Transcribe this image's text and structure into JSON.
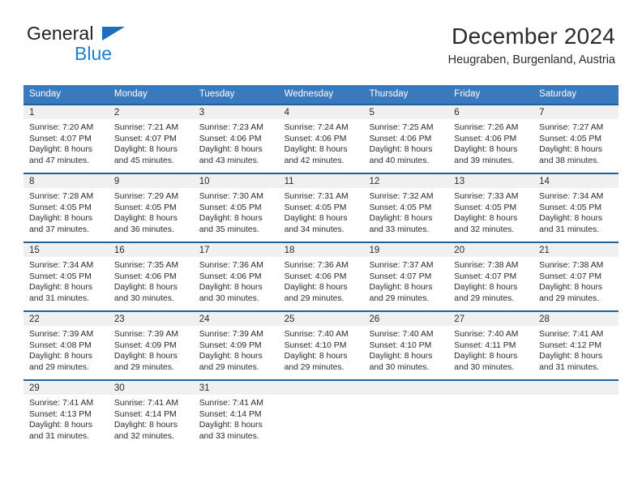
{
  "brand": {
    "name_line1": "General",
    "name_line2": "Blue",
    "triangle_color": "#1b6fc1",
    "blue_text_color": "#1b7fd4"
  },
  "header": {
    "title": "December 2024",
    "subtitle": "Heugraben, Burgenland, Austria"
  },
  "theme": {
    "header_blue": "#3b79bd",
    "cell_border_blue": "#20609f",
    "day_band_gray": "#f0f0f0",
    "text_color": "#2b2b2b"
  },
  "weekdays": [
    "Sunday",
    "Monday",
    "Tuesday",
    "Wednesday",
    "Thursday",
    "Friday",
    "Saturday"
  ],
  "weeks": [
    [
      {
        "day": "1",
        "sunrise": "Sunrise: 7:20 AM",
        "sunset": "Sunset: 4:07 PM",
        "daylight_line1": "Daylight: 8 hours",
        "daylight_line2": "and 47 minutes."
      },
      {
        "day": "2",
        "sunrise": "Sunrise: 7:21 AM",
        "sunset": "Sunset: 4:07 PM",
        "daylight_line1": "Daylight: 8 hours",
        "daylight_line2": "and 45 minutes."
      },
      {
        "day": "3",
        "sunrise": "Sunrise: 7:23 AM",
        "sunset": "Sunset: 4:06 PM",
        "daylight_line1": "Daylight: 8 hours",
        "daylight_line2": "and 43 minutes."
      },
      {
        "day": "4",
        "sunrise": "Sunrise: 7:24 AM",
        "sunset": "Sunset: 4:06 PM",
        "daylight_line1": "Daylight: 8 hours",
        "daylight_line2": "and 42 minutes."
      },
      {
        "day": "5",
        "sunrise": "Sunrise: 7:25 AM",
        "sunset": "Sunset: 4:06 PM",
        "daylight_line1": "Daylight: 8 hours",
        "daylight_line2": "and 40 minutes."
      },
      {
        "day": "6",
        "sunrise": "Sunrise: 7:26 AM",
        "sunset": "Sunset: 4:06 PM",
        "daylight_line1": "Daylight: 8 hours",
        "daylight_line2": "and 39 minutes."
      },
      {
        "day": "7",
        "sunrise": "Sunrise: 7:27 AM",
        "sunset": "Sunset: 4:05 PM",
        "daylight_line1": "Daylight: 8 hours",
        "daylight_line2": "and 38 minutes."
      }
    ],
    [
      {
        "day": "8",
        "sunrise": "Sunrise: 7:28 AM",
        "sunset": "Sunset: 4:05 PM",
        "daylight_line1": "Daylight: 8 hours",
        "daylight_line2": "and 37 minutes."
      },
      {
        "day": "9",
        "sunrise": "Sunrise: 7:29 AM",
        "sunset": "Sunset: 4:05 PM",
        "daylight_line1": "Daylight: 8 hours",
        "daylight_line2": "and 36 minutes."
      },
      {
        "day": "10",
        "sunrise": "Sunrise: 7:30 AM",
        "sunset": "Sunset: 4:05 PM",
        "daylight_line1": "Daylight: 8 hours",
        "daylight_line2": "and 35 minutes."
      },
      {
        "day": "11",
        "sunrise": "Sunrise: 7:31 AM",
        "sunset": "Sunset: 4:05 PM",
        "daylight_line1": "Daylight: 8 hours",
        "daylight_line2": "and 34 minutes."
      },
      {
        "day": "12",
        "sunrise": "Sunrise: 7:32 AM",
        "sunset": "Sunset: 4:05 PM",
        "daylight_line1": "Daylight: 8 hours",
        "daylight_line2": "and 33 minutes."
      },
      {
        "day": "13",
        "sunrise": "Sunrise: 7:33 AM",
        "sunset": "Sunset: 4:05 PM",
        "daylight_line1": "Daylight: 8 hours",
        "daylight_line2": "and 32 minutes."
      },
      {
        "day": "14",
        "sunrise": "Sunrise: 7:34 AM",
        "sunset": "Sunset: 4:05 PM",
        "daylight_line1": "Daylight: 8 hours",
        "daylight_line2": "and 31 minutes."
      }
    ],
    [
      {
        "day": "15",
        "sunrise": "Sunrise: 7:34 AM",
        "sunset": "Sunset: 4:05 PM",
        "daylight_line1": "Daylight: 8 hours",
        "daylight_line2": "and 31 minutes."
      },
      {
        "day": "16",
        "sunrise": "Sunrise: 7:35 AM",
        "sunset": "Sunset: 4:06 PM",
        "daylight_line1": "Daylight: 8 hours",
        "daylight_line2": "and 30 minutes."
      },
      {
        "day": "17",
        "sunrise": "Sunrise: 7:36 AM",
        "sunset": "Sunset: 4:06 PM",
        "daylight_line1": "Daylight: 8 hours",
        "daylight_line2": "and 30 minutes."
      },
      {
        "day": "18",
        "sunrise": "Sunrise: 7:36 AM",
        "sunset": "Sunset: 4:06 PM",
        "daylight_line1": "Daylight: 8 hours",
        "daylight_line2": "and 29 minutes."
      },
      {
        "day": "19",
        "sunrise": "Sunrise: 7:37 AM",
        "sunset": "Sunset: 4:07 PM",
        "daylight_line1": "Daylight: 8 hours",
        "daylight_line2": "and 29 minutes."
      },
      {
        "day": "20",
        "sunrise": "Sunrise: 7:38 AM",
        "sunset": "Sunset: 4:07 PM",
        "daylight_line1": "Daylight: 8 hours",
        "daylight_line2": "and 29 minutes."
      },
      {
        "day": "21",
        "sunrise": "Sunrise: 7:38 AM",
        "sunset": "Sunset: 4:07 PM",
        "daylight_line1": "Daylight: 8 hours",
        "daylight_line2": "and 29 minutes."
      }
    ],
    [
      {
        "day": "22",
        "sunrise": "Sunrise: 7:39 AM",
        "sunset": "Sunset: 4:08 PM",
        "daylight_line1": "Daylight: 8 hours",
        "daylight_line2": "and 29 minutes."
      },
      {
        "day": "23",
        "sunrise": "Sunrise: 7:39 AM",
        "sunset": "Sunset: 4:09 PM",
        "daylight_line1": "Daylight: 8 hours",
        "daylight_line2": "and 29 minutes."
      },
      {
        "day": "24",
        "sunrise": "Sunrise: 7:39 AM",
        "sunset": "Sunset: 4:09 PM",
        "daylight_line1": "Daylight: 8 hours",
        "daylight_line2": "and 29 minutes."
      },
      {
        "day": "25",
        "sunrise": "Sunrise: 7:40 AM",
        "sunset": "Sunset: 4:10 PM",
        "daylight_line1": "Daylight: 8 hours",
        "daylight_line2": "and 29 minutes."
      },
      {
        "day": "26",
        "sunrise": "Sunrise: 7:40 AM",
        "sunset": "Sunset: 4:10 PM",
        "daylight_line1": "Daylight: 8 hours",
        "daylight_line2": "and 30 minutes."
      },
      {
        "day": "27",
        "sunrise": "Sunrise: 7:40 AM",
        "sunset": "Sunset: 4:11 PM",
        "daylight_line1": "Daylight: 8 hours",
        "daylight_line2": "and 30 minutes."
      },
      {
        "day": "28",
        "sunrise": "Sunrise: 7:41 AM",
        "sunset": "Sunset: 4:12 PM",
        "daylight_line1": "Daylight: 8 hours",
        "daylight_line2": "and 31 minutes."
      }
    ],
    [
      {
        "day": "29",
        "sunrise": "Sunrise: 7:41 AM",
        "sunset": "Sunset: 4:13 PM",
        "daylight_line1": "Daylight: 8 hours",
        "daylight_line2": "and 31 minutes."
      },
      {
        "day": "30",
        "sunrise": "Sunrise: 7:41 AM",
        "sunset": "Sunset: 4:14 PM",
        "daylight_line1": "Daylight: 8 hours",
        "daylight_line2": "and 32 minutes."
      },
      {
        "day": "31",
        "sunrise": "Sunrise: 7:41 AM",
        "sunset": "Sunset: 4:14 PM",
        "daylight_line1": "Daylight: 8 hours",
        "daylight_line2": "and 33 minutes."
      },
      {
        "day": "",
        "sunrise": "",
        "sunset": "",
        "daylight_line1": "",
        "daylight_line2": ""
      },
      {
        "day": "",
        "sunrise": "",
        "sunset": "",
        "daylight_line1": "",
        "daylight_line2": ""
      },
      {
        "day": "",
        "sunrise": "",
        "sunset": "",
        "daylight_line1": "",
        "daylight_line2": ""
      },
      {
        "day": "",
        "sunrise": "",
        "sunset": "",
        "daylight_line1": "",
        "daylight_line2": ""
      }
    ]
  ]
}
